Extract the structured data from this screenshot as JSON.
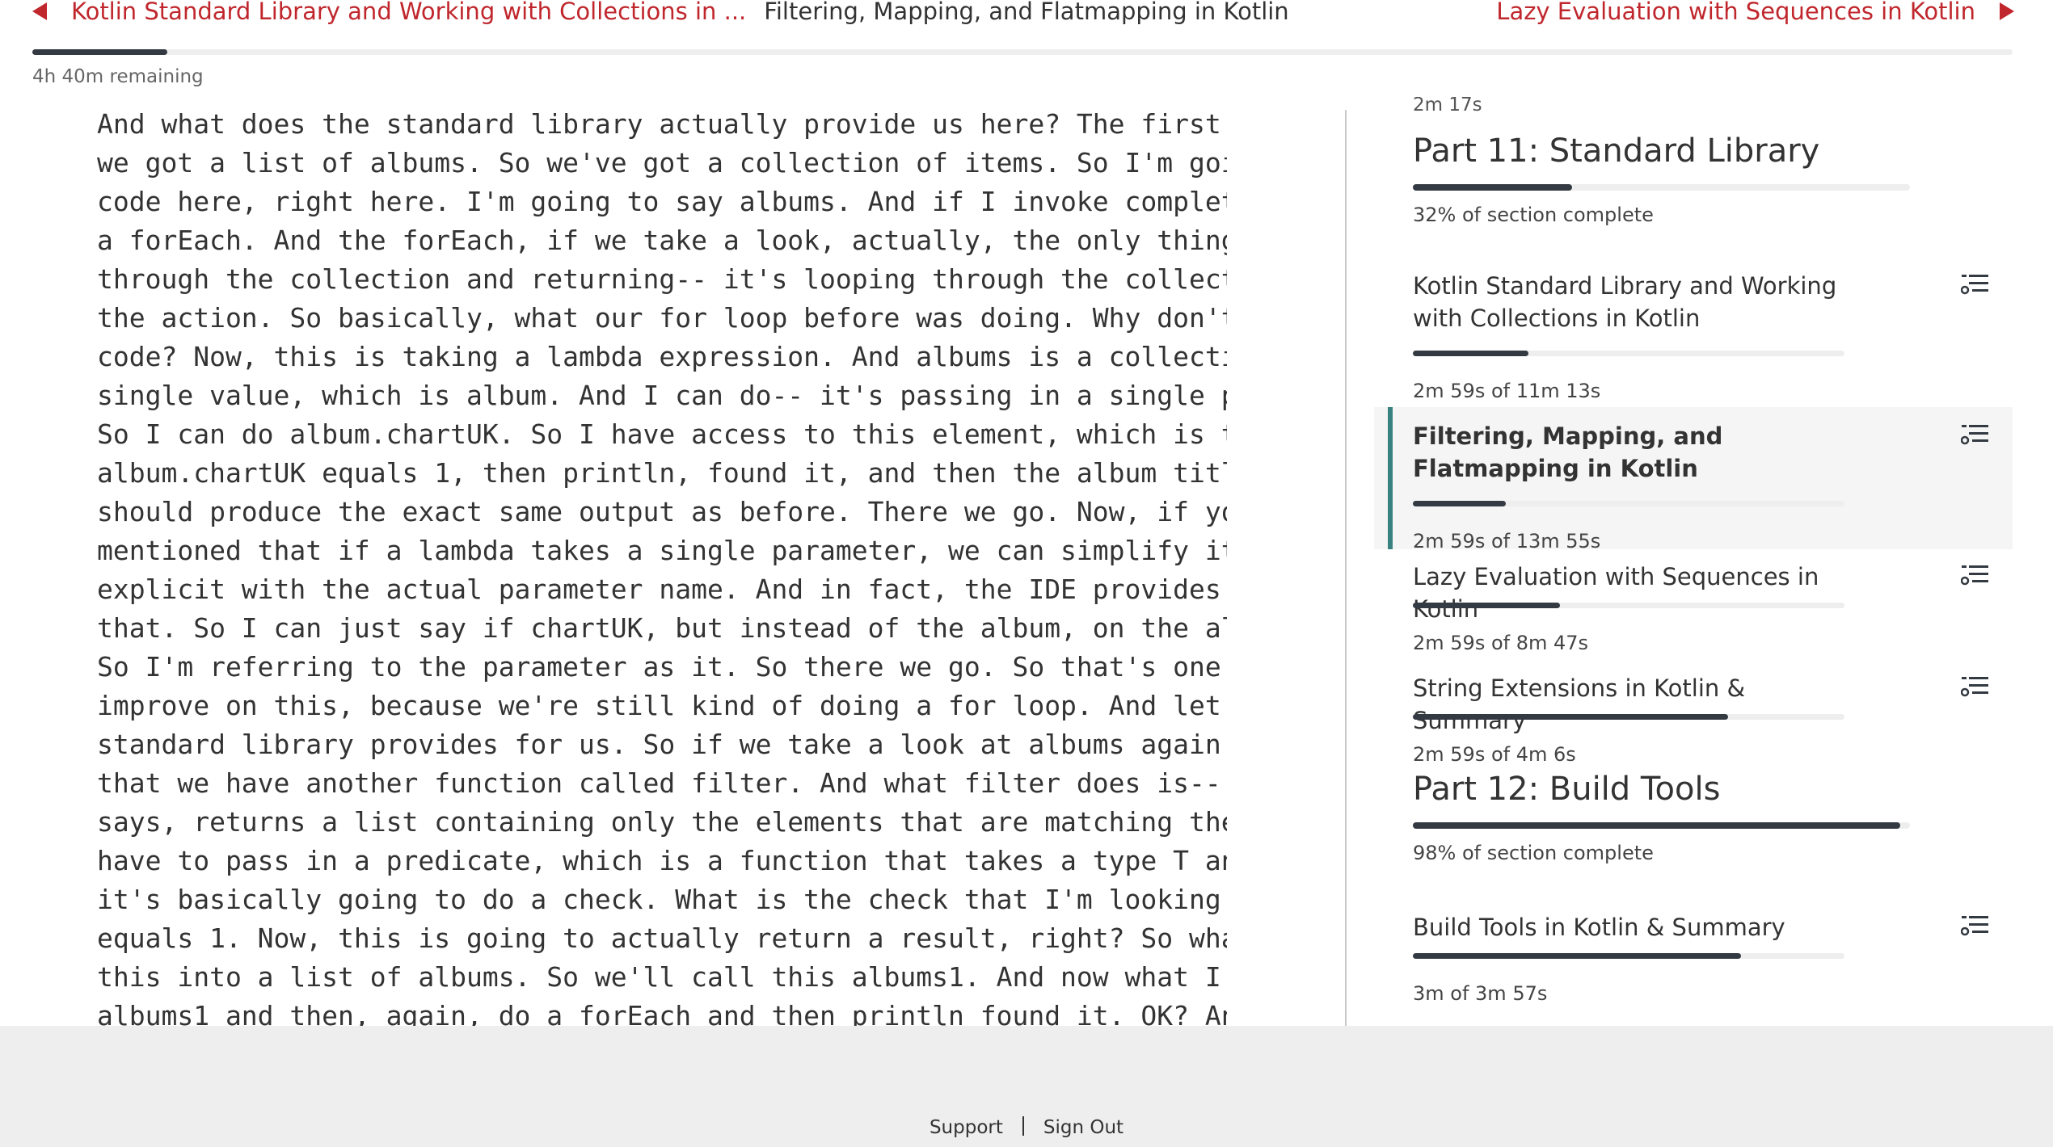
{
  "nav": {
    "prev_label": "Kotlin Standard Library and Working with Collections in ...",
    "current_label": "Filtering, Mapping, and Flatmapping in Kotlin",
    "next_label": "Lazy Evaluation with Sequences in Kotlin"
  },
  "course": {
    "progress_fraction": 0.068,
    "remaining": "4h 40m remaining"
  },
  "transcript": {
    "text": "And what does the standard library actually provide us here? The first thing that we can do is\nwe got a list of albums. So we've got a collection of items. So I'm going to just delete this\ncode here, right here. I'm going to say albums. And if I invoke completion, I can see that I have\na forEach. And the forEach, if we take a look, actually, the only thing that it's doing is looping\nthrough the collection and returning-- it's looping through the collection, and it's executing\nthe action. So basically, what our for loop before was doing. Why don't we do it inside this\ncode? Now, this is taking a lambda expression. And albums is a collection. So it's passing in a\nsingle value, which is album. And I can do-- it's passing in a single parameter, which is album.\nSo I can do album.chartUK. So I have access to this element, which is the album. So I can say if\nalbum.chartUK equals 1, then println, found it, and then the album title. Now, if we run this, it\nshould produce the exact same output as before. There we go. Now, if you remember, we\nmentioned that if a lambda takes a single parameter, we can simplify it. We don't need to be\nexplicit with the actual parameter name. And in fact, the IDE provides us with a quick fix to do\nthat. So I can just say if chartUK, but instead of the album, on the album, I just do it on it. OK?\nSo I'm referring to the parameter as it. So there we go. So that's one step. But let's try and\nimprove on this, because we're still kind of doing a for loop. And let's see what else the\nstandard library provides for us. So if we take a look at albums again and complete, we see\nthat we have another function called filter. And what filter does is-- let's navigate to it. And it\nsays, returns a list containing only the elements that are matching the given predicate. So I\nhave to pass in a predicate, which is a function that takes a type T and returns a Boolean. So\nit's basically going to do a check. What is the check that I'm looking for? Well, it.chartUK\nequals 1. Now, this is going to actually return a result, right? So what I want to do is return\nthis into a list of albums. So we'll call this albums1. And now what I can do is go on this\nalbums1 and then, again, do a forEach and then println found it. OK? And again, I can have\naccess to it.title. But, right, it used to be explicit with this variable declaration, right? And"
  },
  "toc": {
    "truncated_duration": "2m 17s",
    "sections": [
      {
        "title": "Part 11: Standard Library",
        "progress_fraction": 0.32,
        "progress_label": "32% of section complete",
        "lessons": [
          {
            "title": "Kotlin Standard Library and Working with Collections in Kotlin",
            "progress_fraction": 0.267,
            "duration_label": "2m 59s of 11m 13s",
            "active": false
          },
          {
            "title": "Filtering, Mapping, and Flatmapping in Kotlin",
            "progress_fraction": 0.215,
            "duration_label": "2m 59s of 13m 55s",
            "active": true
          },
          {
            "title": "Lazy Evaluation with Sequences in Kotlin",
            "progress_fraction": 0.34,
            "duration_label": "2m 59s of 8m 47s",
            "active": false
          },
          {
            "title": "String Extensions in Kotlin & Summary",
            "progress_fraction": 0.73,
            "duration_label": "2m 59s of 4m 6s",
            "active": false
          }
        ]
      },
      {
        "title": "Part 12: Build Tools",
        "progress_fraction": 0.98,
        "progress_label": "98% of section complete",
        "lessons": [
          {
            "title": "Build Tools in Kotlin & Summary",
            "progress_fraction": 0.76,
            "duration_label": "3m of 3m 57s",
            "active": false
          }
        ]
      }
    ]
  },
  "icons": {
    "lesson_menu": "list-icon",
    "prev": "caret-left-icon",
    "next": "caret-right-icon"
  },
  "colors": {
    "link_red": "#c0272d",
    "active_accent": "#3a8282",
    "bar_fill": "#333a42",
    "bar_track": "#eeeeee",
    "footer_bg": "#eeeeee"
  },
  "footer": {
    "support_label": "Support",
    "signout_label": "Sign Out"
  }
}
